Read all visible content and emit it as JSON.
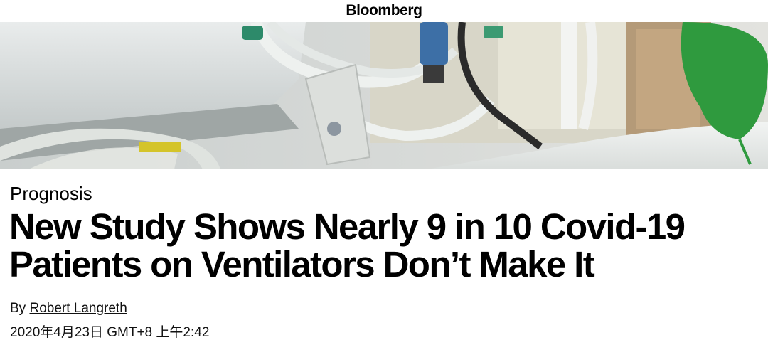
{
  "masthead": {
    "logo_text": "Bloomberg"
  },
  "hero": {
    "image_desc": "hospital-bed-ventilator-photo"
  },
  "article": {
    "kicker": "Prognosis",
    "headline_line1": "New Study Shows Nearly 9 in 10 Covid-19",
    "headline_line2": "Patients on Ventilators Don’t Make It",
    "byline_prefix": "By",
    "author": "Robert Langreth",
    "timestamp": "2020年4月23日 GMT+8 上午2:42"
  }
}
